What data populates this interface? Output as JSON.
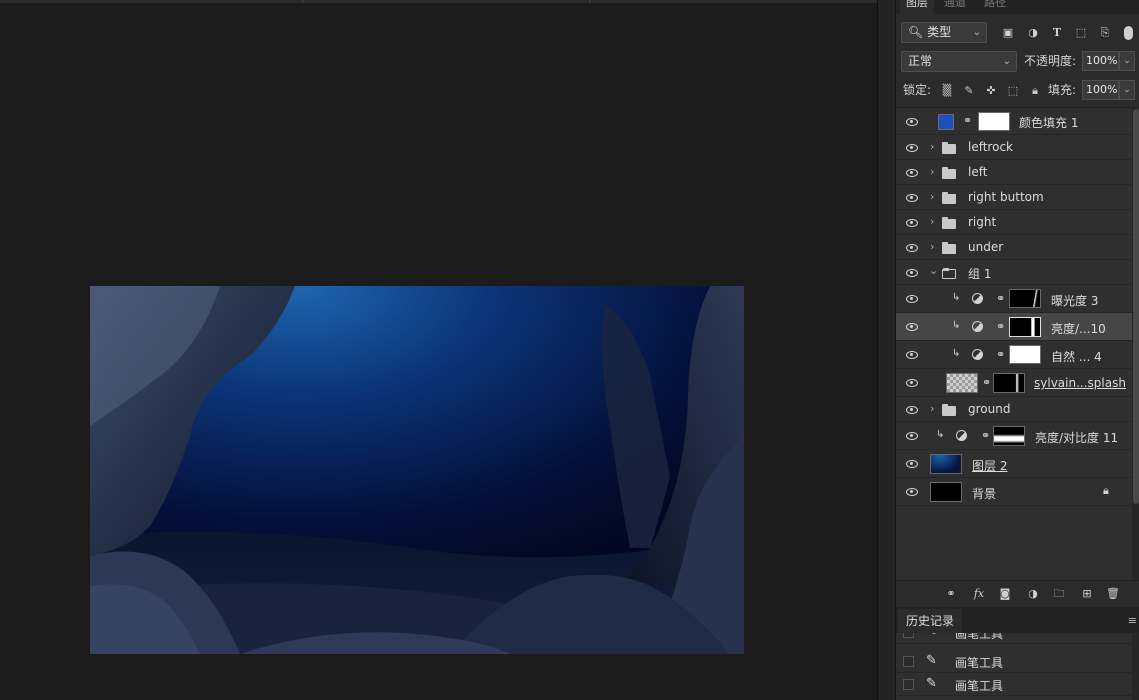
{
  "panel_tabs": [
    "图层",
    "通道",
    "路径"
  ],
  "filter": {
    "kind_label": "类型",
    "icons": [
      "image-filter-icon",
      "adjustment-filter-icon",
      "type-filter-icon",
      "shape-filter-icon",
      "smartobject-filter-icon"
    ]
  },
  "blend": {
    "mode": "正常",
    "opacity_label": "不透明度:",
    "opacity": "100%"
  },
  "lock": {
    "label": "锁定:",
    "fill_label": "填充:",
    "fill": "100%"
  },
  "layers": [
    {
      "name": "颜色填充 1",
      "type": "fill",
      "color": "#1c4fbf"
    },
    {
      "name": "leftrock",
      "type": "group"
    },
    {
      "name": "left",
      "type": "group"
    },
    {
      "name": "right buttom",
      "type": "group"
    },
    {
      "name": "right",
      "type": "group"
    },
    {
      "name": "under",
      "type": "group"
    },
    {
      "name": "组 1",
      "type": "group-open"
    },
    {
      "name": "曝光度 3",
      "type": "adjustment"
    },
    {
      "name": "亮度/...10",
      "type": "adjustment",
      "selected": true
    },
    {
      "name": "自然 ... 4",
      "type": "adjustment"
    },
    {
      "name": "sylvain...splash",
      "type": "smart"
    },
    {
      "name": "ground",
      "type": "group"
    },
    {
      "name": "亮度/对比度 11",
      "type": "adjustment"
    },
    {
      "name": "图层 2",
      "type": "pixel"
    },
    {
      "name": "背景",
      "type": "background",
      "locked": true
    }
  ],
  "history": {
    "tab_label": "历史记录",
    "items": [
      "画笔工具",
      "画笔工具",
      "画笔工具"
    ]
  }
}
